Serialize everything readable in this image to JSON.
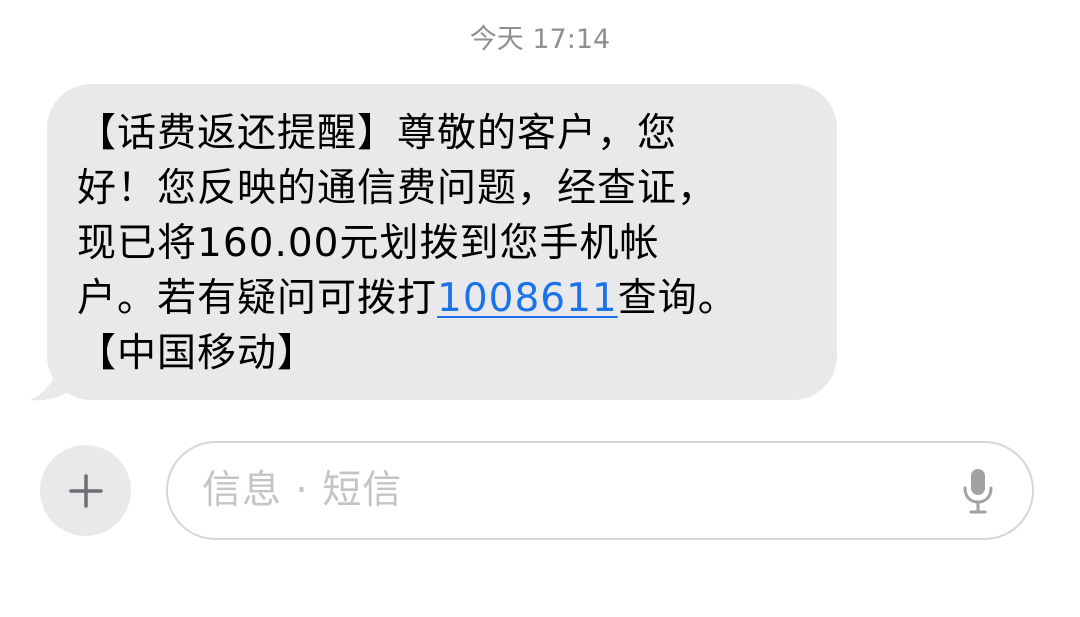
{
  "conversation": {
    "timestamp": "今天 17:14"
  },
  "message": {
    "line1": "【话费返还提醒】尊敬的客户，您",
    "line2": "好！您反映的通信费问题，经查证，",
    "line3": "现已将160.00元划拨到您手机帐",
    "line4_before": "户。若有疑问可拨打",
    "phone_number": "1008611",
    "line4_after": "查询。",
    "line5": "【中国移动】"
  },
  "composer": {
    "placeholder": "信息 · 短信",
    "value": ""
  },
  "colors": {
    "bubble": "#e9e9eb",
    "link": "#1a73e8",
    "timestamp": "#8e8e93",
    "placeholder": "#c4c4c7"
  },
  "icons": {
    "add": "plus-icon",
    "dictation": "microphone-icon"
  }
}
